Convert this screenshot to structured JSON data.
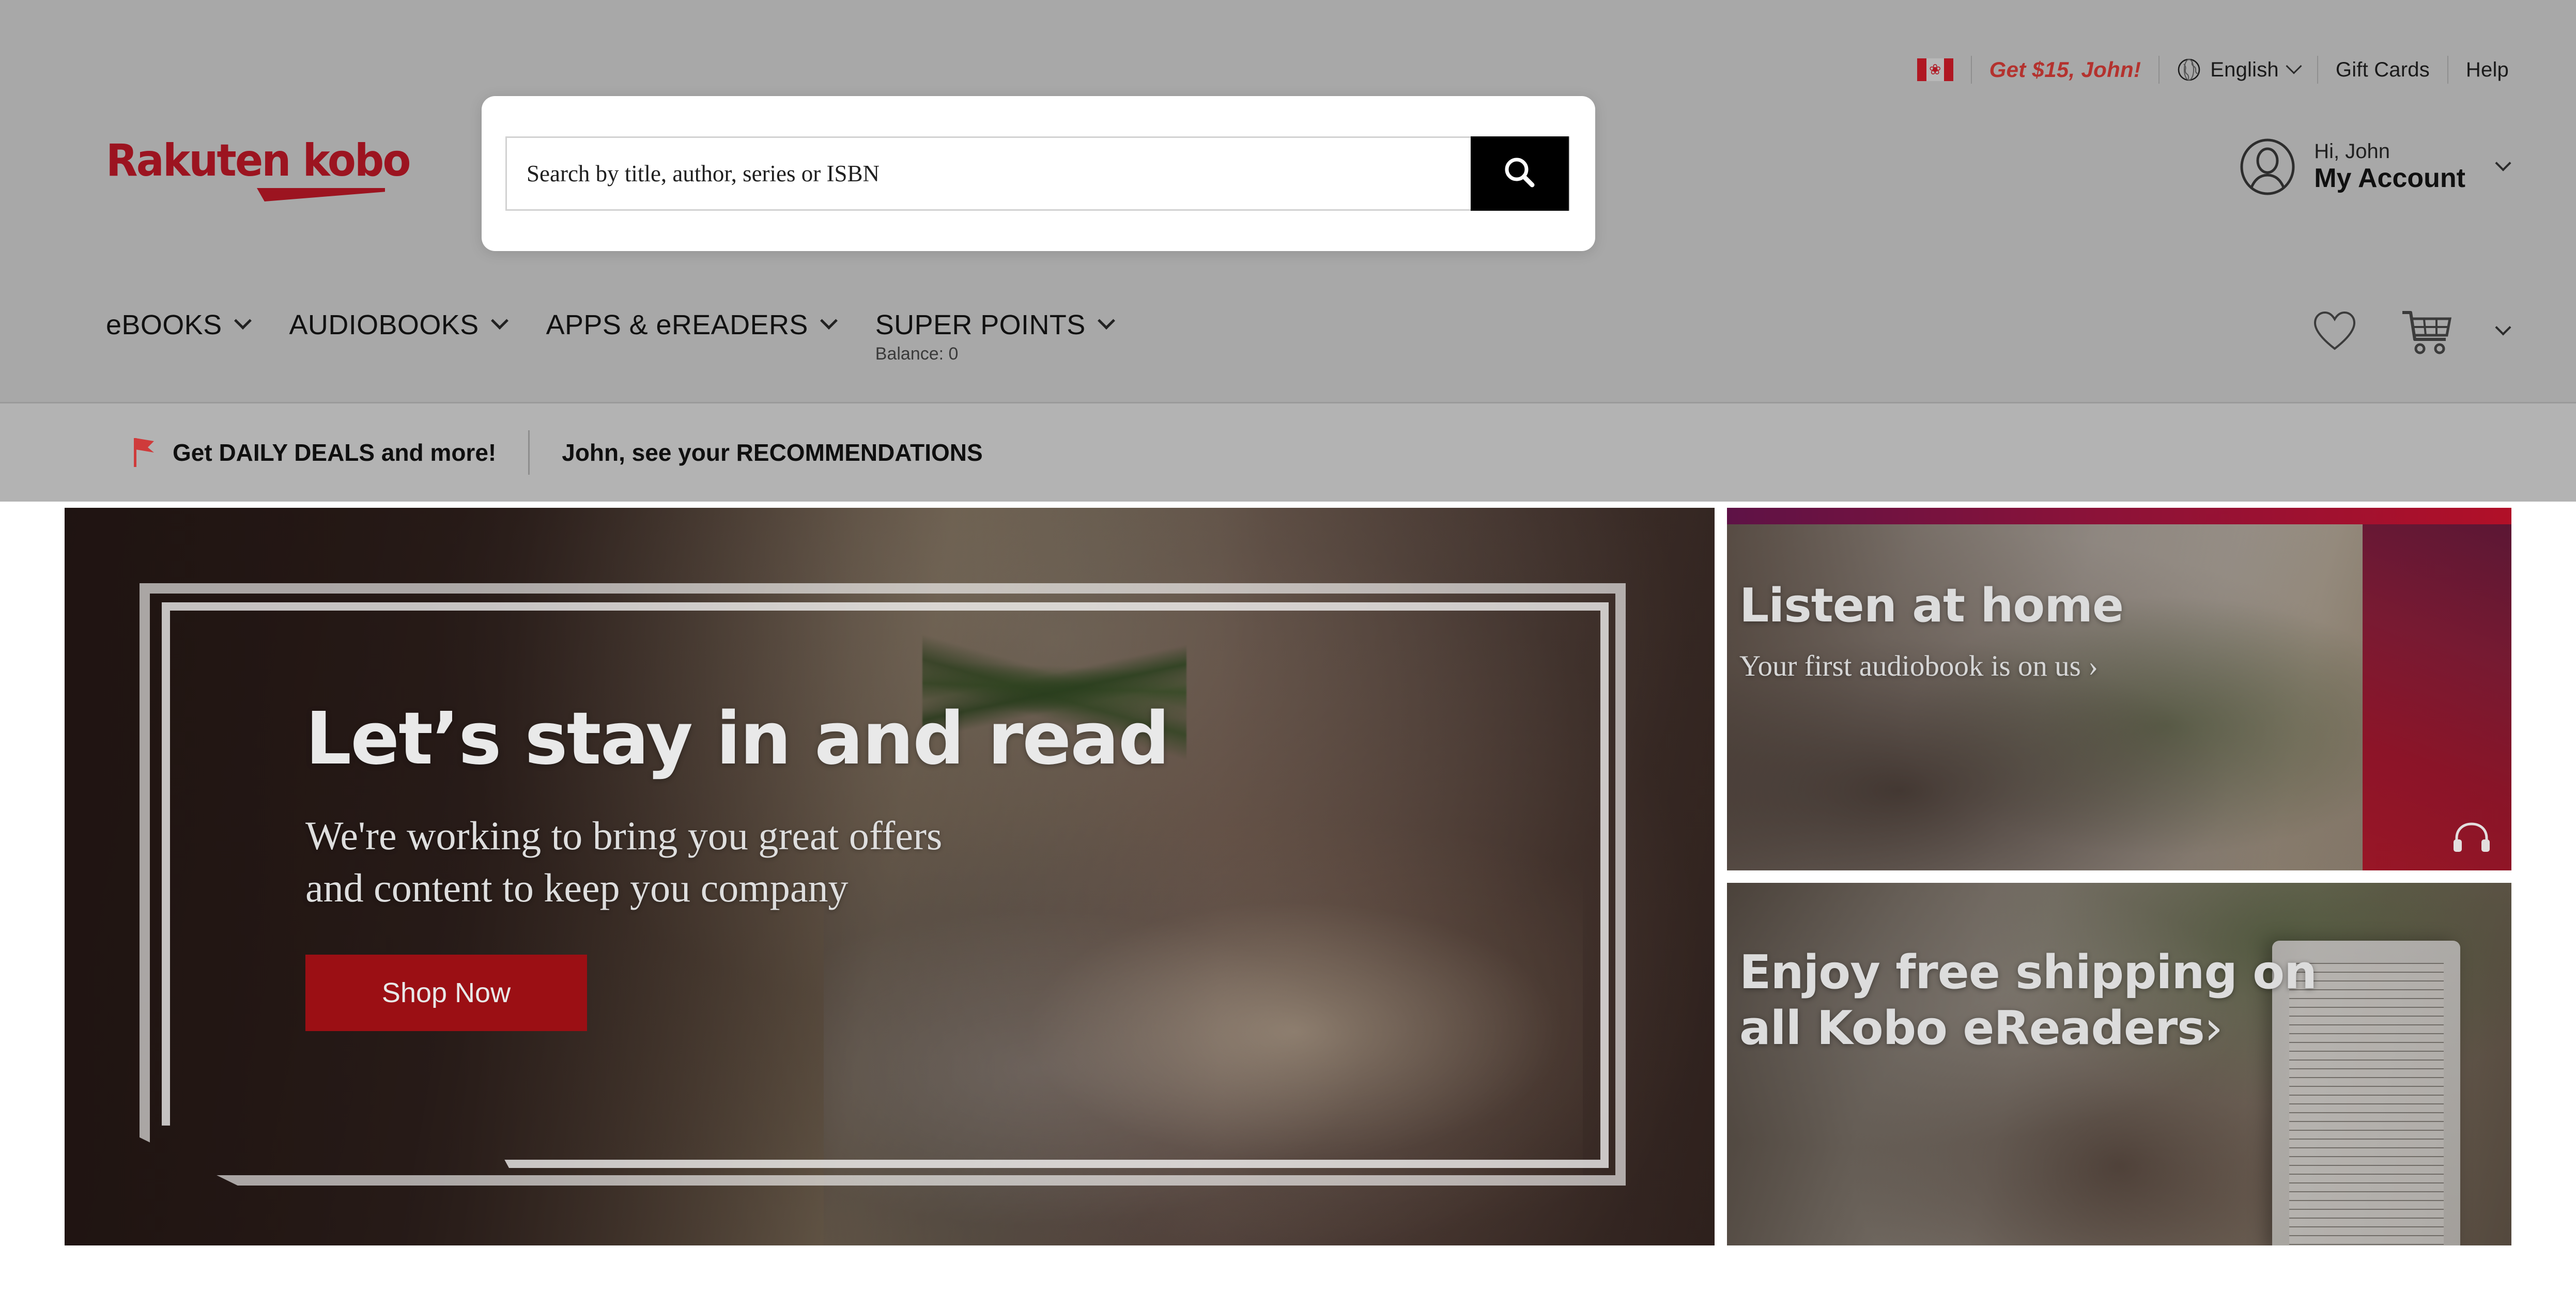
{
  "brand": {
    "logo_text": "Rakuten kobo",
    "accent_red": "#9c1420",
    "cta_red": "#9b0f14",
    "promo_red": "#b4322e"
  },
  "utility_bar": {
    "flag_icon": "canada-flag-icon",
    "flag_leaf": "❀",
    "credit_offer": "Get $15, John!",
    "globe_icon": "globe-icon",
    "language": "English",
    "language_chevron": "chevron-down-icon",
    "gift_cards": "Gift Cards",
    "help": "Help"
  },
  "search": {
    "placeholder": "Search by title, author, series or ISBN",
    "value": "",
    "submit_icon": "search-icon"
  },
  "account": {
    "avatar_icon": "user-avatar-icon",
    "greeting": "Hi, John",
    "title": "My Account",
    "chevron": "chevron-down-icon"
  },
  "main_nav": {
    "items": [
      {
        "label": "eBOOKS",
        "chevron": "chevron-down-icon"
      },
      {
        "label": "AUDIOBOOKS",
        "chevron": "chevron-down-icon"
      },
      {
        "label": "APPS & eREADERS",
        "chevron": "chevron-down-icon"
      },
      {
        "label": "SUPER POINTS",
        "chevron": "chevron-down-icon",
        "sublabel": "Balance: 0"
      }
    ],
    "actions": {
      "wishlist_icon": "heart-icon",
      "cart_icon": "shopping-cart-icon",
      "cart_chevron": "chevron-down-icon"
    }
  },
  "promo_bar": {
    "flag_icon": "red-flag-icon",
    "deals_link": "Get DAILY DEALS and more!",
    "recommendations_link": "John, see your RECOMMENDATIONS"
  },
  "hero": {
    "headline": "Let’s stay in and read",
    "subtext": "We're working to bring you great offers and content to keep you company",
    "cta_label": "Shop Now"
  },
  "promo_cards": [
    {
      "headline": "Listen at home",
      "subtext": "Your first audiobook is on us",
      "arrow": "›",
      "icon": "headphones-icon",
      "accent": "#b11028"
    },
    {
      "headline": "Enjoy free shipping on all Kobo eReaders",
      "arrow": "›"
    }
  ]
}
